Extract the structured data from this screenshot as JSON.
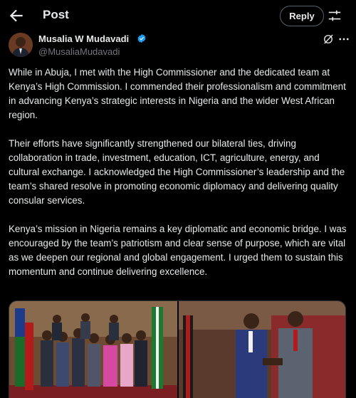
{
  "header": {
    "title": "Post",
    "reply_label": "Reply"
  },
  "author": {
    "name": "Musalia W Mudavadi",
    "handle": "@MusaliaMudavadi"
  },
  "post": {
    "paragraphs": [
      "While in Abuja, I met with the High Commissioner and the dedicated team at Kenya’s High Commission. I commended their professionalism and commitment in advancing Kenya’s strategic interests in Nigeria and the wider West African region.",
      "Their efforts have significantly strengthened our bilateral ties, driving collaboration in trade, investment, education, ICT, agriculture, energy, and cultural exchange. I acknowledged the High Commissioner’s leadership and the team’s shared resolve in promoting economic diplomacy and delivering quality consular services.",
      "Kenya’s mission in Nigeria remains a key diplomatic and economic bridge. I was encouraged by the team’s patriotism and clear sense of purpose, which are vital as we deepen our regional and global engagement. I urged them to sustain this momentum and continue delivering excellence."
    ]
  },
  "media": [
    {
      "description_icon": "group-photo"
    },
    {
      "description_icon": "handshake-photo"
    }
  ],
  "colors": {
    "background": "#000000",
    "text": "#e7e9ea",
    "muted": "#71767b",
    "verified": "#1d9bf0"
  }
}
